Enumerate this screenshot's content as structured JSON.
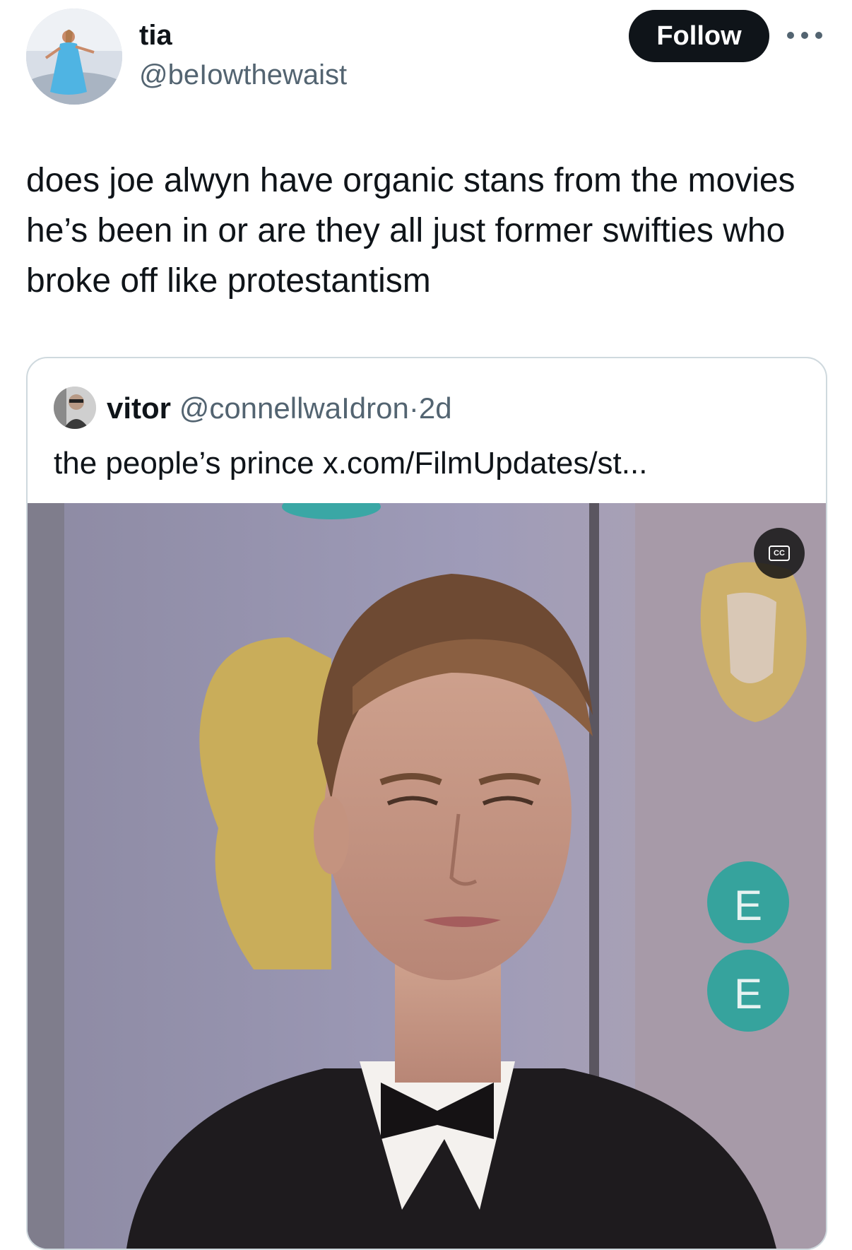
{
  "post": {
    "author": {
      "display_name": "tia",
      "handle": "@beIowthewaist",
      "avatar_icon": "avatar-image"
    },
    "follow_label": "Follow",
    "more_icon": "more-dots-icon",
    "text": "does joe alwyn have organic stans from the movies he’s been in or are they all just former swifties who broke off like protestantism"
  },
  "quote": {
    "author": {
      "display_name": "vitor",
      "handle": "@connellwaIdron",
      "separator": "·",
      "time": "2d"
    },
    "text": "the people’s prince x.com/FilmUpdates/st...",
    "media": {
      "type": "video",
      "cc_label": "CC",
      "cc_icon": "closed-captions-icon"
    }
  },
  "colors": {
    "text_primary": "#0f1419",
    "text_secondary": "#536471",
    "button_bg": "#0f1419",
    "button_text": "#ffffff",
    "card_border": "#cfd9de"
  }
}
